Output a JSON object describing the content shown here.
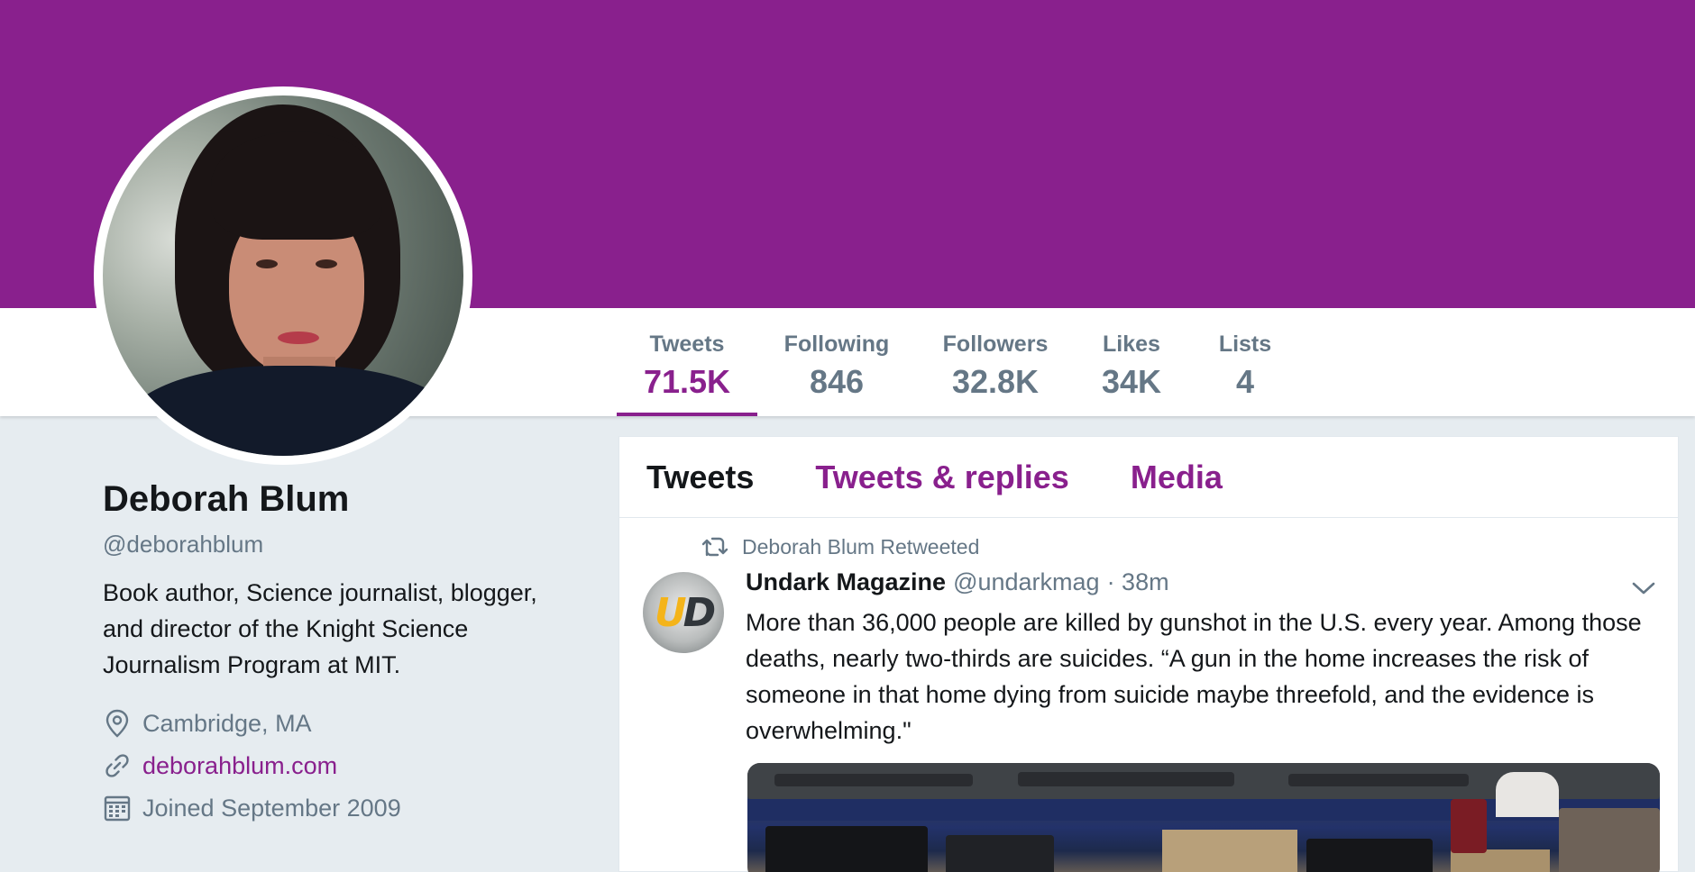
{
  "colors": {
    "brand": "#89208d",
    "muted": "#657786",
    "text": "#14171a",
    "bg": "#e6ecf0"
  },
  "stats": [
    {
      "label": "Tweets",
      "value": "71.5K"
    },
    {
      "label": "Following",
      "value": "846"
    },
    {
      "label": "Followers",
      "value": "32.8K"
    },
    {
      "label": "Likes",
      "value": "34K"
    },
    {
      "label": "Lists",
      "value": "4"
    }
  ],
  "profile": {
    "name": "Deborah Blum",
    "handle": "@deborahblum",
    "bio": "Book author, Science journalist, blogger, and director of the Knight Science Journalism Program at MIT.",
    "location": "Cambridge, MA",
    "website": "deborahblum.com",
    "joined": "Joined September 2009"
  },
  "timeline_tabs": [
    "Tweets",
    "Tweets & replies",
    "Media"
  ],
  "tweet": {
    "retweet_label": "Deborah Blum Retweeted",
    "author_name": "Undark Magazine",
    "author_handle": "@undarkmag",
    "time": "· 38m",
    "avatar_text": "UD",
    "text": "More than 36,000 people are killed by gunshot in the U.S. every year. Among those deaths, nearly two-thirds are suicides. “A gun in the home increases the risk of someone in that home dying from suicide maybe threefold, and the evidence is overwhelming.\""
  },
  "icons": {
    "location": "location-pin-icon",
    "website": "link-icon",
    "joined": "calendar-icon",
    "retweet": "retweet-icon",
    "caret": "chevron-down-icon"
  }
}
